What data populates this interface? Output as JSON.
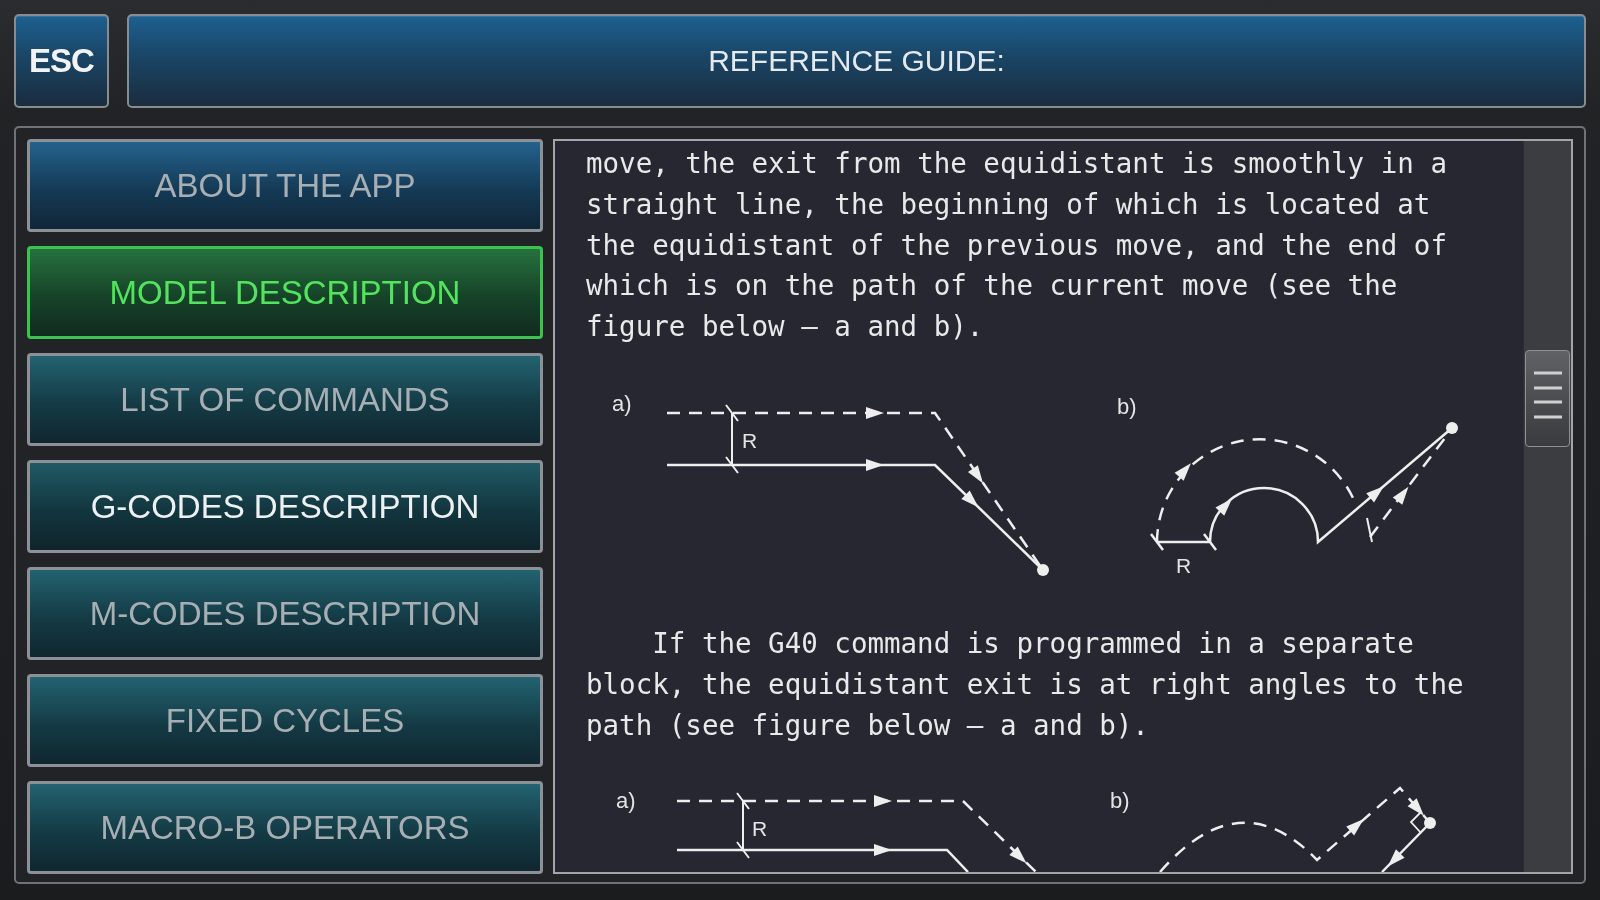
{
  "esc_button": {
    "label": "ESC"
  },
  "title_bar": {
    "title": "REFERENCE GUIDE:"
  },
  "sidebar": {
    "items": [
      {
        "label": "ABOUT THE APP",
        "selected": false,
        "highlighted": false,
        "color": "#1b5b88"
      },
      {
        "label": "MODEL DESCRIPTION",
        "selected": true,
        "highlighted": false,
        "color": "#1e6b36"
      },
      {
        "label": "LIST OF COMMANDS",
        "selected": false,
        "highlighted": false,
        "color": "#1a5c6a"
      },
      {
        "label": "G-CODES DESCRIPTION",
        "selected": false,
        "highlighted": true,
        "color": "#17535e"
      },
      {
        "label": "M-CODES DESCRIPTION",
        "selected": false,
        "highlighted": false,
        "color": "#1a5c6a"
      },
      {
        "label": "FIXED CYCLES",
        "selected": false,
        "highlighted": false,
        "color": "#1a5c6a"
      },
      {
        "label": "MACRO-B OPERATORS",
        "selected": false,
        "highlighted": false,
        "color": "#1a5c6a"
      }
    ]
  },
  "content": {
    "blocks": [
      {
        "kind": "paragraph",
        "indent": false,
        "text": "move, the exit from the equidistant is smoothly in a straight line, the beginning of which is located at the equidistant of the previous move, and the end of which is on the path of the current move (see the figure below – a and b)."
      },
      {
        "kind": "figure",
        "panels": [
          {
            "kind": "line-smooth",
            "label": "a)",
            "dimension": "R"
          },
          {
            "kind": "arc-smooth",
            "label": "b)",
            "dimension": "R"
          }
        ]
      },
      {
        "kind": "paragraph",
        "indent": true,
        "text": "If the G40 command is programmed in a separate block, the equidistant exit is at right angles to the path (see figure below – a and b)."
      },
      {
        "kind": "figure",
        "panels": [
          {
            "kind": "line-square",
            "label": "a)",
            "dimension": "R"
          },
          {
            "kind": "arc-square",
            "label": "b)"
          }
        ]
      }
    ]
  }
}
